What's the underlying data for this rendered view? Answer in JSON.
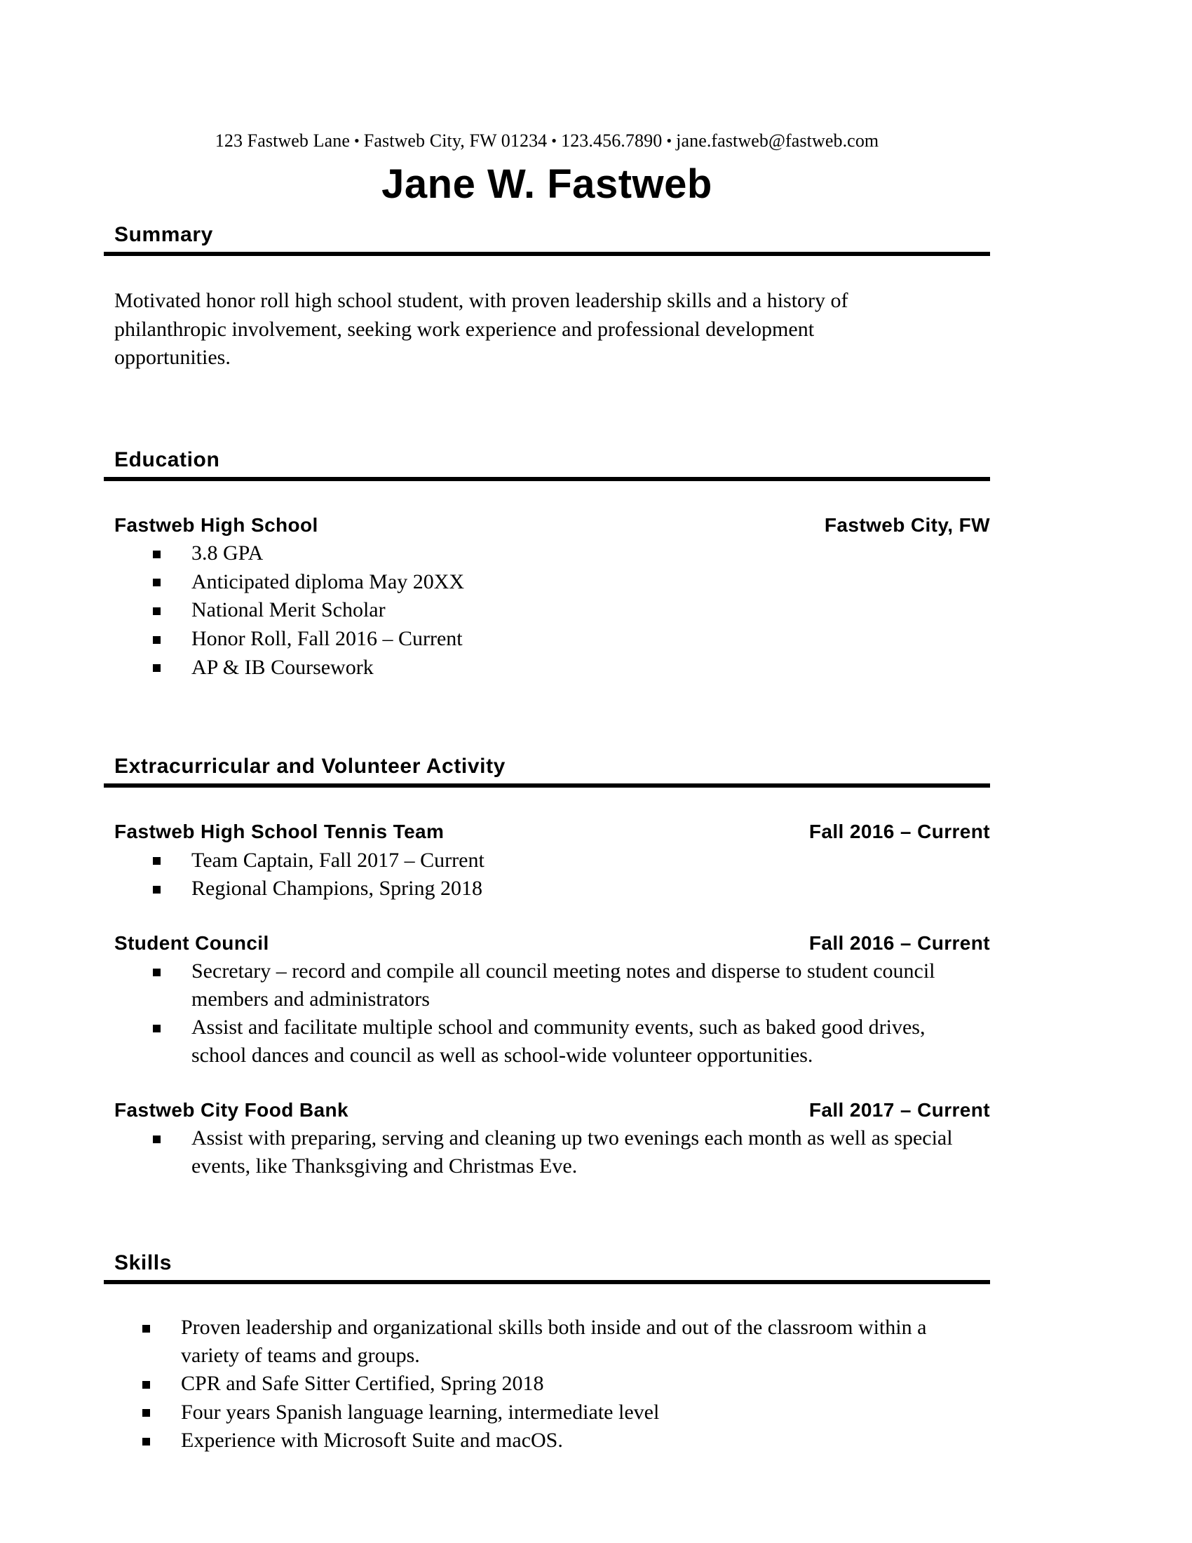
{
  "document": {
    "type": "resume",
    "contact": {
      "address": "123 Fastweb Lane",
      "city_state_zip": "Fastweb City, FW 01234",
      "phone": "123.456.7890",
      "email": "jane.fastweb@fastweb.com",
      "separator": "•"
    },
    "name": "Jane W. Fastweb",
    "sections": {
      "summary": {
        "heading": "Summary",
        "text": "Motivated honor roll high school student, with proven leadership skills and a history of philanthropic involvement, seeking work experience and professional development opportunities."
      },
      "education": {
        "heading": "Education",
        "entries": [
          {
            "organization": "Fastweb High School",
            "meta": "Fastweb City, FW",
            "bullets": [
              "3.8 GPA",
              "Anticipated diploma May 20XX",
              "National Merit Scholar",
              "Honor Roll, Fall 2016 – Current",
              "AP & IB Coursework"
            ]
          }
        ]
      },
      "extracurricular": {
        "heading": "Extracurricular and Volunteer Activity",
        "entries": [
          {
            "organization": "Fastweb High School Tennis Team",
            "meta": "Fall 2016 – Current",
            "bullets": [
              "Team Captain, Fall 2017 – Current",
              "Regional Champions, Spring 2018"
            ]
          },
          {
            "organization": "Student Council",
            "meta": "Fall 2016 – Current",
            "bullets": [
              "Secretary – record and compile all council meeting notes and disperse to student council members and administrators",
              "Assist and facilitate multiple school and community events, such as baked good drives, school dances and council as well as school-wide volunteer opportunities."
            ]
          },
          {
            "organization": "Fastweb City Food Bank",
            "meta": "Fall 2017 – Current",
            "bullets": [
              "Assist with preparing, serving and cleaning up two evenings each month as well as special events, like Thanksgiving and Christmas Eve."
            ]
          }
        ]
      },
      "skills": {
        "heading": "Skills",
        "bullets": [
          "Proven leadership and organizational skills both inside and out of the classroom within a variety of teams and groups.",
          "CPR and Safe Sitter Certified, Spring 2018",
          "Four years Spanish language learning, intermediate level",
          "Experience with Microsoft Suite and macOS."
        ]
      }
    }
  }
}
